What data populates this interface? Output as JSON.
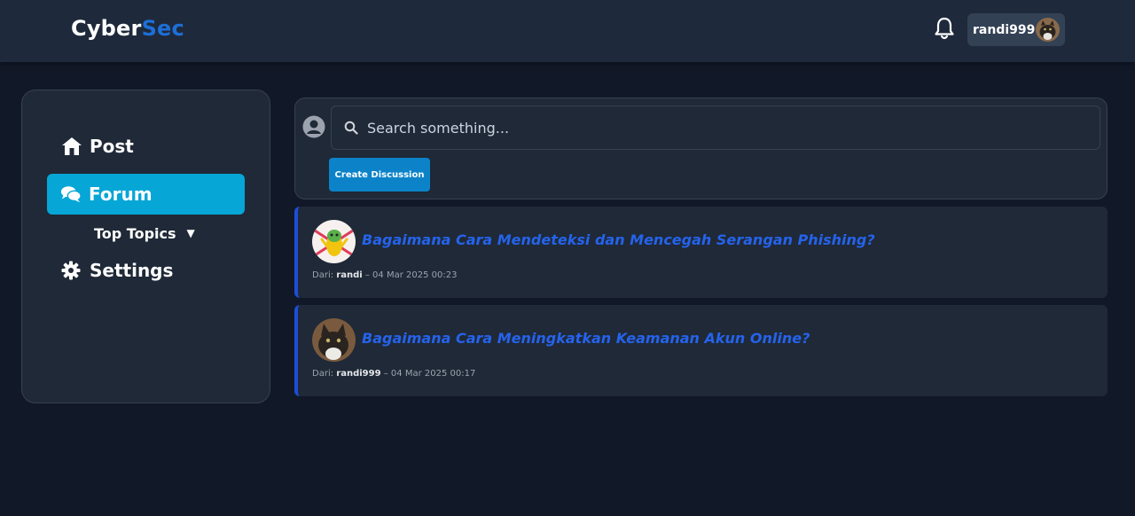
{
  "header": {
    "brand_part1": "Cyber",
    "brand_part2": "Sec",
    "username": "randi999",
    "icons": {
      "notifications": "bell-icon",
      "avatar": "user-avatar"
    }
  },
  "sidebar": {
    "items": [
      {
        "label": "Post",
        "icon": "home-icon",
        "active": false
      },
      {
        "label": "Forum",
        "icon": "chat-bubbles-icon",
        "active": true
      },
      {
        "label": "Top Topics",
        "icon": "caret-down-icon",
        "active": false
      },
      {
        "label": "Settings",
        "icon": "gear-icon",
        "active": false
      }
    ]
  },
  "composer": {
    "search_placeholder": "Search something...",
    "create_label": "Create Discussion"
  },
  "posts": [
    {
      "title": "Bagaimana Cara Mendeteksi dan Mencegah Serangan Phishing?",
      "from_label": "Dari:",
      "author": "randi",
      "separator": "–",
      "date": "04 Mar 2025 00:23"
    },
    {
      "title": "Bagaimana Cara Meningkatkan Keamanan Akun Online?",
      "from_label": "Dari:",
      "author": "randi999",
      "separator": "–",
      "date": "04 Mar 2025 00:17"
    }
  ],
  "colors": {
    "background": "#111827",
    "header": "#1e293b",
    "card": "#1f2937",
    "accent_forum": "#06a6d6",
    "brand_accent": "#1d6fd8",
    "title_link": "#2563eb",
    "button": "#0c83c9"
  }
}
